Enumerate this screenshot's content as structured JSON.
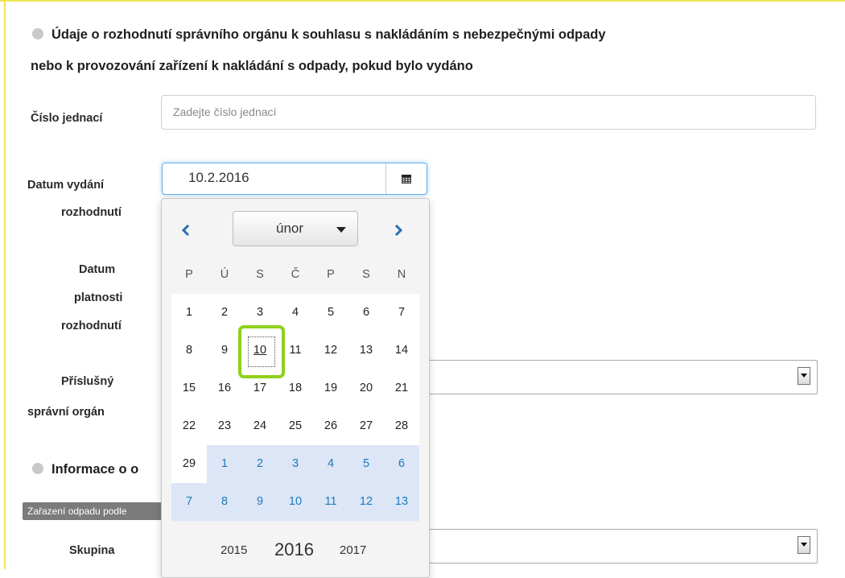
{
  "section1": {
    "title_line1": "Údaje o rozhodnutí správního orgánu k souhlasu s nakládáním s nebezpečnými odpady",
    "title_line2": "nebo k provozování zařízení k nakládání s odpady, pokud bylo vydáno"
  },
  "fields": {
    "cislo_label": "Číslo jednací",
    "cislo_placeholder": "Zadejte číslo jednací",
    "datum_vydani_label_1": "Datum vydání",
    "datum_vydani_label_2": "rozhodnutí",
    "datum_vydani_value": "10.2.2016",
    "datum_platnosti_label_1": "Datum",
    "datum_platnosti_label_2": "platnosti",
    "datum_platnosti_label_3": "rozhodnutí",
    "organ_label_1": "Příslušný",
    "organ_label_2": "správní orgán",
    "skupina_label": "Skupina"
  },
  "section2": {
    "title_partial": "Informace o o",
    "tag": "Zařazení odpadu podle"
  },
  "datepicker": {
    "month": "únor",
    "weekdays": [
      "P",
      "Ú",
      "S",
      "Č",
      "P",
      "S",
      "N"
    ],
    "weeks": [
      [
        {
          "d": "1",
          "t": "cur"
        },
        {
          "d": "2",
          "t": "cur"
        },
        {
          "d": "3",
          "t": "cur"
        },
        {
          "d": "4",
          "t": "cur"
        },
        {
          "d": "5",
          "t": "cur"
        },
        {
          "d": "6",
          "t": "cur"
        },
        {
          "d": "7",
          "t": "cur"
        }
      ],
      [
        {
          "d": "8",
          "t": "cur"
        },
        {
          "d": "9",
          "t": "cur"
        },
        {
          "d": "10",
          "t": "sel"
        },
        {
          "d": "11",
          "t": "cur"
        },
        {
          "d": "12",
          "t": "cur"
        },
        {
          "d": "13",
          "t": "cur"
        },
        {
          "d": "14",
          "t": "cur"
        }
      ],
      [
        {
          "d": "15",
          "t": "cur"
        },
        {
          "d": "16",
          "t": "cur"
        },
        {
          "d": "17",
          "t": "cur"
        },
        {
          "d": "18",
          "t": "cur"
        },
        {
          "d": "19",
          "t": "cur"
        },
        {
          "d": "20",
          "t": "cur"
        },
        {
          "d": "21",
          "t": "cur"
        }
      ],
      [
        {
          "d": "22",
          "t": "cur"
        },
        {
          "d": "23",
          "t": "cur"
        },
        {
          "d": "24",
          "t": "cur"
        },
        {
          "d": "25",
          "t": "cur"
        },
        {
          "d": "26",
          "t": "cur"
        },
        {
          "d": "27",
          "t": "cur"
        },
        {
          "d": "28",
          "t": "cur"
        }
      ],
      [
        {
          "d": "29",
          "t": "cur"
        },
        {
          "d": "1",
          "t": "other"
        },
        {
          "d": "2",
          "t": "other"
        },
        {
          "d": "3",
          "t": "other"
        },
        {
          "d": "4",
          "t": "other"
        },
        {
          "d": "5",
          "t": "other"
        },
        {
          "d": "6",
          "t": "other"
        }
      ],
      [
        {
          "d": "7",
          "t": "other"
        },
        {
          "d": "8",
          "t": "other"
        },
        {
          "d": "9",
          "t": "other"
        },
        {
          "d": "10",
          "t": "other"
        },
        {
          "d": "11",
          "t": "other"
        },
        {
          "d": "12",
          "t": "other"
        },
        {
          "d": "13",
          "t": "other"
        }
      ]
    ],
    "years": {
      "prev": "2015",
      "current": "2016",
      "next": "2017"
    }
  },
  "icons": {
    "calendar": "calendar-icon",
    "prev": "chevron-left-icon",
    "next": "chevron-right-icon"
  },
  "colors": {
    "accent": "#1e7ab8",
    "highlight": "#8fd11c",
    "frame": "#f2e35a"
  }
}
